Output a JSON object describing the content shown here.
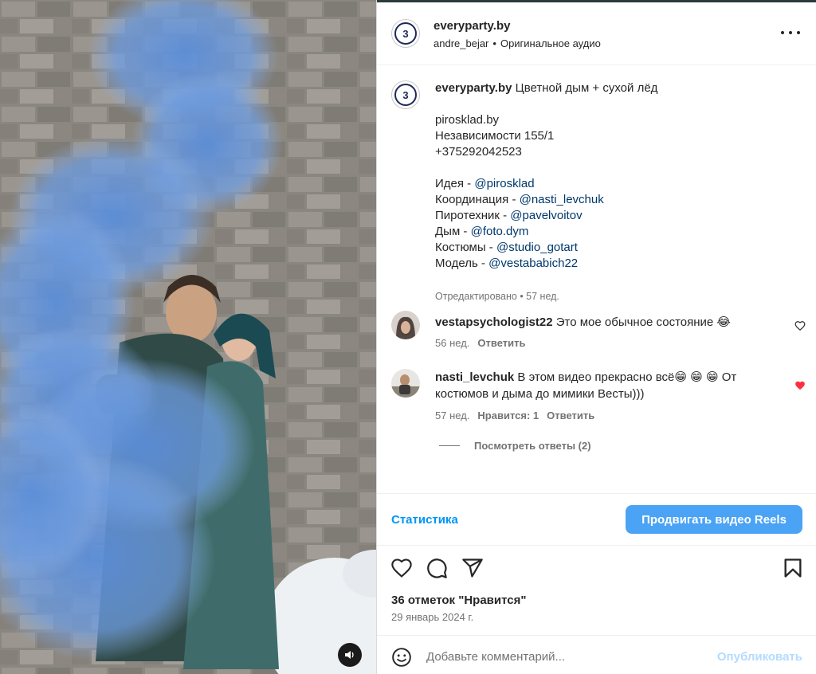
{
  "post": {
    "author": "everyparty.by",
    "audio_user": "andre_bejar",
    "audio_sep": "•",
    "audio_label": "Оригинальное аудио",
    "avatar_text": "3"
  },
  "caption": {
    "author": "everyparty.by",
    "title": "Цветной дым + сухой лёд",
    "lines": {
      "l1": "pirosklad.by",
      "l2": "Независимости 155/1",
      "l3": "+375292042523",
      "idea": "Идея - ",
      "idea_m": "@pirosklad",
      "coord": "Координация - ",
      "coord_m": "@nasti_levchuk",
      "pyro": "Пиротехник - ",
      "pyro_m": "@pavelvoitov",
      "smoke": "Дым - ",
      "smoke_m": "@foto.dym",
      "costume": "Костюмы - ",
      "costume_m": "@studio_gotart",
      "model": "Модель - ",
      "model_m": "@vestababich22"
    },
    "meta": "Отредактировано • 57 нед."
  },
  "comments": [
    {
      "user": "vestapsychologist22",
      "text": "Это мое обычное состояние 😂",
      "age": "56 нед.",
      "reply": "Ответить",
      "liked": false
    },
    {
      "user": "nasti_levchuk",
      "text": "В этом видео прекрасно всё😁 😁 😁 От костюмов и дыма до мимики Весты)))",
      "age": "57 нед.",
      "likes": "Нравится: 1",
      "reply": "Ответить",
      "liked": true
    }
  ],
  "view_replies": "Посмотреть ответы (2)",
  "promo": {
    "stats": "Статистика",
    "boost": "Продвигать видео Reels"
  },
  "likes_text": "36 отметок \"Нравится\"",
  "date_text": "29 январь 2024 г.",
  "add_comment": {
    "placeholder": "Добавьте комментарий...",
    "publish": "Опубликовать"
  },
  "colors": {
    "link": "#00376b",
    "accent": "#0095f6",
    "like_red": "#ff3040",
    "smoke_blue": "#6f9de0"
  }
}
